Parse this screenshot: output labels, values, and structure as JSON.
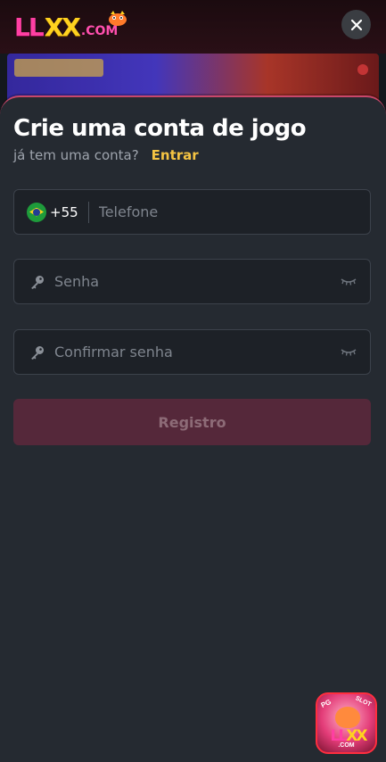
{
  "header": {
    "logo": {
      "part1": "LL",
      "part2": "XX",
      "suffix": ".COM"
    },
    "close_icon": "close-icon"
  },
  "form": {
    "title": "Crie uma conta de jogo",
    "subtitle": "já tem uma conta?",
    "login_link": "Entrar",
    "phone": {
      "country_flag": "brazil-flag-icon",
      "dial_code": "+55",
      "placeholder": "Telefone",
      "value": ""
    },
    "password": {
      "placeholder": "Senha",
      "value": "",
      "icon": "key-icon",
      "toggle_icon": "eye-closed-icon"
    },
    "confirm_password": {
      "placeholder": "Confirmar senha",
      "value": "",
      "icon": "key-icon",
      "toggle_icon": "eye-closed-icon"
    },
    "submit_label": "Registro"
  },
  "app_badge": {
    "left_tag": "PG",
    "right_tag": "SLOT",
    "word1": "LL",
    "word2": "XX",
    "suffix": ".COM"
  },
  "colors": {
    "sheet_bg": "#252a31",
    "accent_link": "#f5c443",
    "submit_bg": "#55283a",
    "sheet_border": "#c9476a"
  }
}
